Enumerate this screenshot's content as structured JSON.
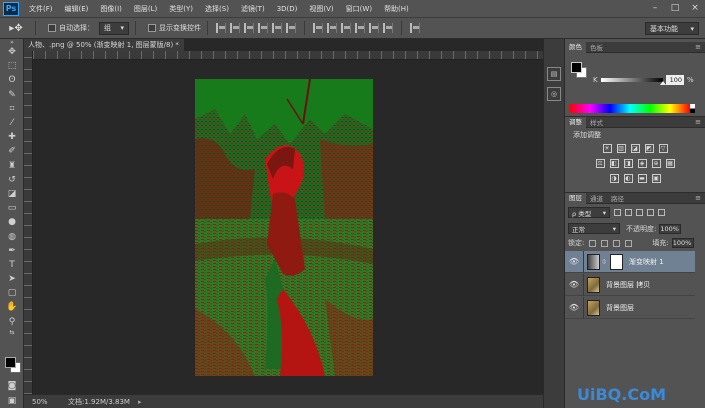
{
  "menubar": {
    "logo": "Ps",
    "items": [
      "文件(F)",
      "编辑(E)",
      "图像(I)",
      "图层(L)",
      "类型(Y)",
      "选择(S)",
      "滤镜(T)",
      "3D(D)",
      "视图(V)",
      "窗口(W)",
      "帮助(H)"
    ],
    "window_controls": [
      "–",
      "□",
      "×"
    ]
  },
  "options": {
    "auto_select_label": "自动选择：",
    "auto_select_value": "组",
    "show_transform_label": "显示变换控件",
    "workspace": "基本功能"
  },
  "document": {
    "tab_title": "人物、.png @ 50% (渐变映射 1, 图层蒙版/8) *",
    "tab_close": "×",
    "zoom": "50%",
    "doc_info": "文档:1.92M/3.83M"
  },
  "color_panel": {
    "tabs": [
      "颜色",
      "色板"
    ],
    "channel_label": "K",
    "k_value": "100",
    "k_unit": "%",
    "k_fraction": 1.0
  },
  "adjust_panel": {
    "tabs": [
      "调整",
      "样式"
    ],
    "title": "添加调整",
    "row1": [
      "☀",
      "▥",
      "◪",
      "◩",
      "▽"
    ],
    "row2": [
      "⚖",
      "◧",
      "◨",
      "◈",
      "⊕",
      "▦"
    ],
    "row3": [
      "◑",
      "◐",
      "▬",
      "▣"
    ]
  },
  "layers_panel": {
    "tabs": [
      "图层",
      "通道",
      "路径"
    ],
    "filter_label": "ρ 类型",
    "blend_mode": "正常",
    "opacity_label": "不透明度:",
    "opacity_value": "100%",
    "lock_label": "锁定:",
    "fill_label": "填充:",
    "fill_value": "100%",
    "layers": [
      {
        "name": "渐变映射 1",
        "selected": true
      },
      {
        "name": "背景图层 拷贝",
        "selected": false
      },
      {
        "name": "背景图层",
        "selected": false
      }
    ]
  },
  "watermark": {
    "text": "UiBQ.CoM"
  }
}
